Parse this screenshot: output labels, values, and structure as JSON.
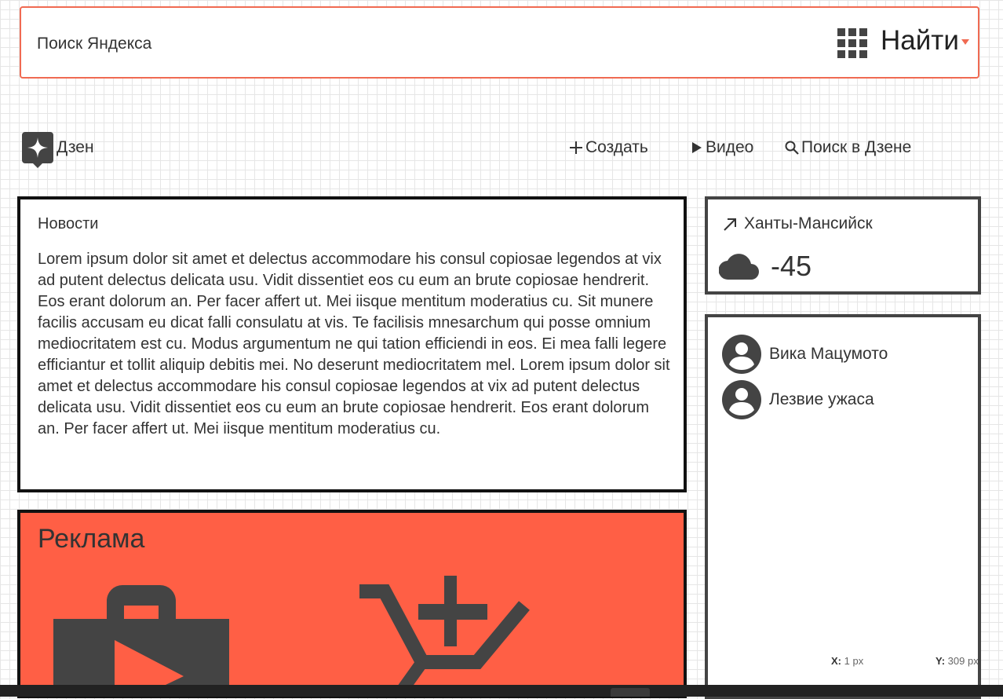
{
  "search": {
    "placeholder": "Поиск Яндекса",
    "button_label": "Найти",
    "apps_icon": "apps-grid-icon",
    "accent_color": "#f06a52"
  },
  "nav": {
    "brand_label": "Дзен",
    "brand_icon": "zen-star-icon",
    "items": [
      {
        "label": "Создать",
        "icon": "plus-icon"
      },
      {
        "label": "Видео",
        "icon": "play-icon"
      },
      {
        "label": "Поиск в Дзене",
        "icon": "search-icon"
      }
    ]
  },
  "news": {
    "title": "Новости",
    "body": "Lorem ipsum dolor sit amet et delectus accommodare his consul copiosae legendos at vix ad putent delectus delicata usu. Vidit dissentiet eos cu eum an brute copiosae hendrerit. Eos erant dolorum an. Per facer affert ut. Mei iisque mentitum moderatius cu. Sit munere facilis accusam eu dicat falli consulatu at vis. Te facilisis mnesarchum qui posse omnium mediocritatem est cu. Modus argumentum ne qui tation efficiendi in eos. Ei mea falli legere efficiantur et tollit aliquip debitis mei. No deserunt mediocritatem mel. Lorem ipsum dolor sit amet et delectus accommodare his consul copiosae legendos at vix ad putent delectus delicata usu. Vidit dissentiet eos cu eum an brute copiosae hendrerit. Eos erant dolorum an. Per facer affert ut. Mei iisque mentitum moderatius cu."
  },
  "ad": {
    "title": "Реклама",
    "background_color": "#ff5f45",
    "icons": [
      "briefcase-play-icon",
      "cart-add-icon"
    ]
  },
  "weather": {
    "city": "Ханты-Мансийск",
    "temperature": "-45",
    "icon": "cloud-icon"
  },
  "users": {
    "items": [
      {
        "name": "Вика Мацумото",
        "icon": "account-icon"
      },
      {
        "name": "Лезвие ужаса",
        "icon": "account-icon"
      }
    ]
  },
  "coords": {
    "x_label": "X:",
    "x_value": "1 px",
    "y_label": "Y:",
    "y_value": "309 px"
  }
}
